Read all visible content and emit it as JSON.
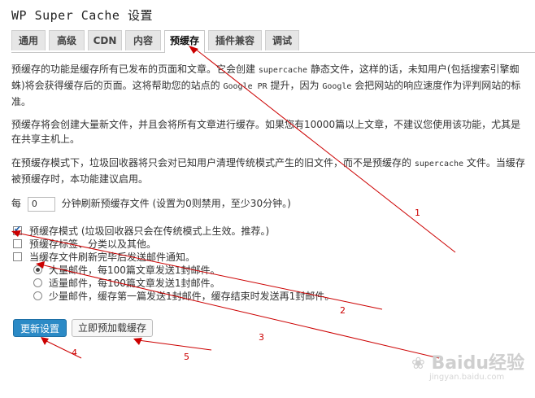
{
  "page": {
    "title": "WP Super Cache 设置"
  },
  "tabs": [
    {
      "label": "通用"
    },
    {
      "label": "高级"
    },
    {
      "label": "CDN"
    },
    {
      "label": "内容"
    },
    {
      "label": "预缓存"
    },
    {
      "label": "插件兼容"
    },
    {
      "label": "调试"
    }
  ],
  "active_tab": "预缓存",
  "content": {
    "para1_a": "预缓存的功能是缓存所有已发布的页面和文章。它会创建 ",
    "para1_code": "supercache",
    "para1_b": " 静态文件，这样的话，未知用户(包括搜索引擎蜘蛛)将会获得缓存后的页面。这将帮助您的站点的 ",
    "para1_code2": "Google PR",
    "para1_c": " 提升，因为 ",
    "para1_code3": "Google",
    "para1_d": " 会把网站的响应速度作为评判网站的标准。",
    "para2": "预缓存将会创建大量新文件，并且会将所有文章进行缓存。如果您有10000篇以上文章，不建议您使用该功能，尤其是在共享主机上。",
    "para3_a": "在预缓存模式下，垃圾回收器将只会对已知用户清理传统模式产生的旧文件，而不是预缓存的 ",
    "para3_code": "supercache",
    "para3_b": " 文件。当缓存被预缓存时，本功能建议启用。",
    "refresh_prefix": "每",
    "refresh_value": "0",
    "refresh_suffix": "分钟刷新预缓存文件 (设置为0则禁用，至少30分钟。)"
  },
  "checkboxes": [
    {
      "label": "预缓存模式 (垃圾回收器只会在传统模式上生效。推荐。)",
      "checked": true
    },
    {
      "label": "预缓存标签、分类以及其他。",
      "checked": false
    },
    {
      "label": "当缓存文件刷新完毕后发送邮件通知。",
      "checked": false
    }
  ],
  "radios": [
    {
      "label": "大量邮件，每100篇文章发送1封邮件。",
      "checked": true
    },
    {
      "label": "适量邮件，每100篇文章发送1封邮件。",
      "checked": false
    },
    {
      "label": "少量邮件，缓存第一篇发送1封邮件，缓存结束时发送再1封邮件。",
      "checked": false
    }
  ],
  "buttons": {
    "update": "更新设置",
    "preload_now": "立即预加载缓存"
  },
  "annotations": {
    "n1": "1",
    "n2": "2",
    "n3": "3",
    "n4": "4",
    "n5": "5",
    "color": "#cc0000"
  },
  "watermark": {
    "text": "Baidu经验",
    "sub": "jingyan.baidu.com"
  }
}
